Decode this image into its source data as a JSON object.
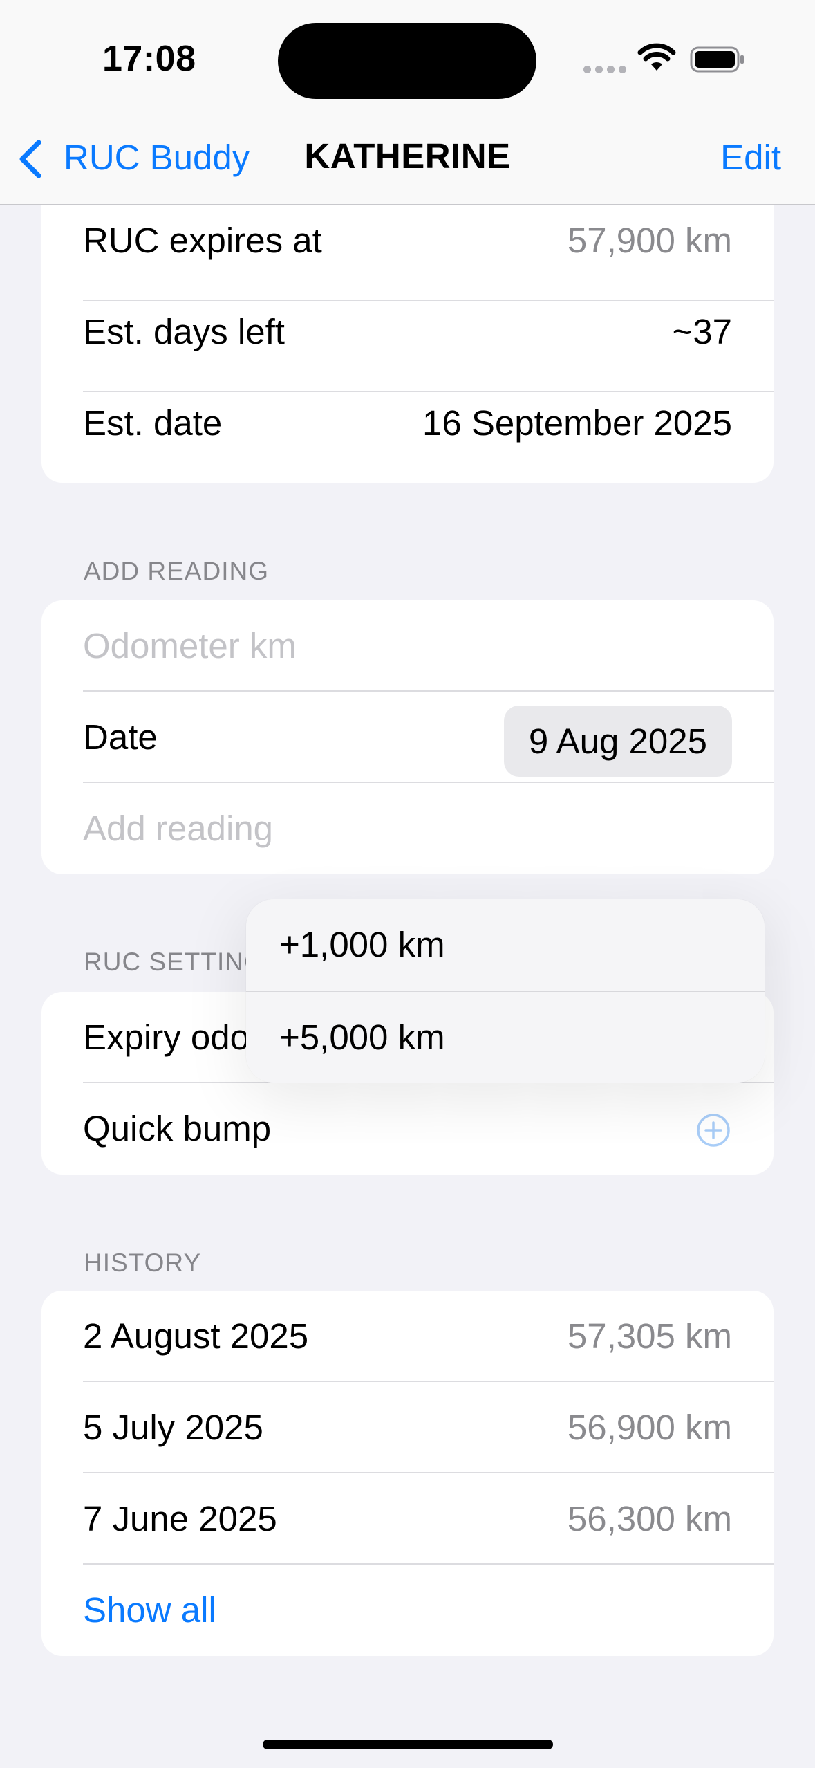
{
  "status_bar": {
    "time": "17:08"
  },
  "nav": {
    "back_label": "RUC Buddy",
    "title": "KATHERINE",
    "edit_label": "Edit"
  },
  "summary": {
    "rows": [
      {
        "label": "RUC expires at",
        "value": "57,900 km"
      },
      {
        "label": "Est. days left",
        "value": "~37"
      },
      {
        "label": "Est. date",
        "value": "16 September 2025"
      }
    ]
  },
  "add_reading": {
    "header": "ADD READING",
    "odometer_placeholder": "Odometer km",
    "date_label": "Date",
    "date_value": "9 Aug 2025",
    "add_label": "Add reading"
  },
  "ruc_settings": {
    "header": "RUC SETTINGS",
    "expiry_label": "Expiry odometer",
    "quick_bump_label": "Quick bump"
  },
  "bump_menu": {
    "items": [
      "+1,000 km",
      "+5,000 km"
    ]
  },
  "history": {
    "header": "HISTORY",
    "rows": [
      {
        "date": "2 August 2025",
        "km": "57,305 km"
      },
      {
        "date": "5 July 2025",
        "km": "56,900 km"
      },
      {
        "date": "7 June 2025",
        "km": "56,300 km"
      }
    ],
    "show_all": "Show all"
  },
  "colors": {
    "accent": "#0a7aff",
    "background": "#f2f2f7",
    "secondary_text": "#8a8a8e"
  },
  "icons": {
    "back": "chevron-left-icon",
    "wifi": "wifi-icon",
    "battery": "battery-icon",
    "plus": "plus-circle-icon"
  }
}
